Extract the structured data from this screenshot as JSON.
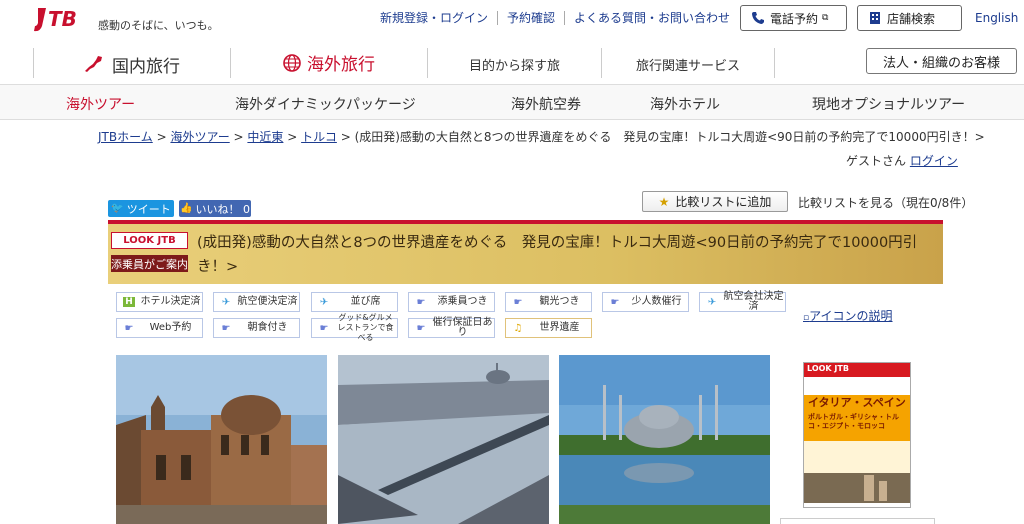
{
  "header": {
    "tagline": "感動のそばに、いつも。",
    "links": [
      "新規登録・ログイン",
      "予約確認",
      "よくある質問・お問い合わせ"
    ],
    "phone_button": "電話予約",
    "store_button": "店舗検索",
    "english": "English",
    "logo_text": "JTB"
  },
  "mainnav": {
    "domestic": "国内旅行",
    "overseas": "海外旅行",
    "purpose": "目的から探す旅",
    "services": "旅行関連サービス",
    "corporate": "法人・組織のお客様"
  },
  "subnav": [
    "海外ツアー",
    "海外ダイナミックパッケージ",
    "海外航空券",
    "海外ホテル",
    "現地オプショナルツアー"
  ],
  "breadcrumb": {
    "home": "JTBホーム",
    "tour": "海外ツアー",
    "region": "中近東",
    "country": "トルコ",
    "current": "(成田発)感動の大自然と8つの世界遺産をめぐる　発見の宝庫！トルコ大周遊<90日前の予約完了で10000円引き！>",
    "sep": " > "
  },
  "user": {
    "guest": "ゲストさん",
    "login": "ログイン"
  },
  "social": {
    "tweet": "ツイート",
    "like": "いいね！ 0"
  },
  "compare": {
    "add": "比較リストに追加",
    "view": "比較リストを見る（現在0/8件）"
  },
  "tour": {
    "badge": "LOOK JTB",
    "conductor": "添乗員がご案内",
    "title": "(成田発)感動の大自然と8つの世界遺産をめぐる　発見の宝庫！トルコ大周遊<90日前の予約完了で10000円引き！>"
  },
  "tags": [
    {
      "label": "ホテル決定済",
      "icon": "hotel-icon"
    },
    {
      "label": "航空便決定済",
      "icon": "plane-icon"
    },
    {
      "label": "並び席",
      "icon": "plane-icon"
    },
    {
      "label": "添乗員つき",
      "icon": "hand-icon"
    },
    {
      "label": "観光つき",
      "icon": "hand-icon"
    },
    {
      "label": "少人数催行",
      "icon": "hand-icon"
    },
    {
      "label": "航空会社決定済",
      "icon": "plane-icon"
    },
    {
      "label": "Web予約",
      "icon": "hand-icon"
    },
    {
      "label": "朝食付き",
      "icon": "hand-icon"
    },
    {
      "label": "グッド&グルメ レストランで食べる",
      "icon": "hand-icon"
    },
    {
      "label": "催行保証日あり",
      "icon": "hand-icon"
    },
    {
      "label": "世界遺産",
      "icon": "music-icon"
    }
  ],
  "icon_help": "アイコンの説明",
  "pamphlet": {
    "brand": "LOOK JTB",
    "title": "イタリア・スペイン",
    "subtitle": "ポルトガル・ギリシャ・トルコ・エジプト・モロッコ"
  },
  "colors": {
    "accent": "#c8102e",
    "link": "#1d3c8f",
    "band": "#dcbf62"
  }
}
